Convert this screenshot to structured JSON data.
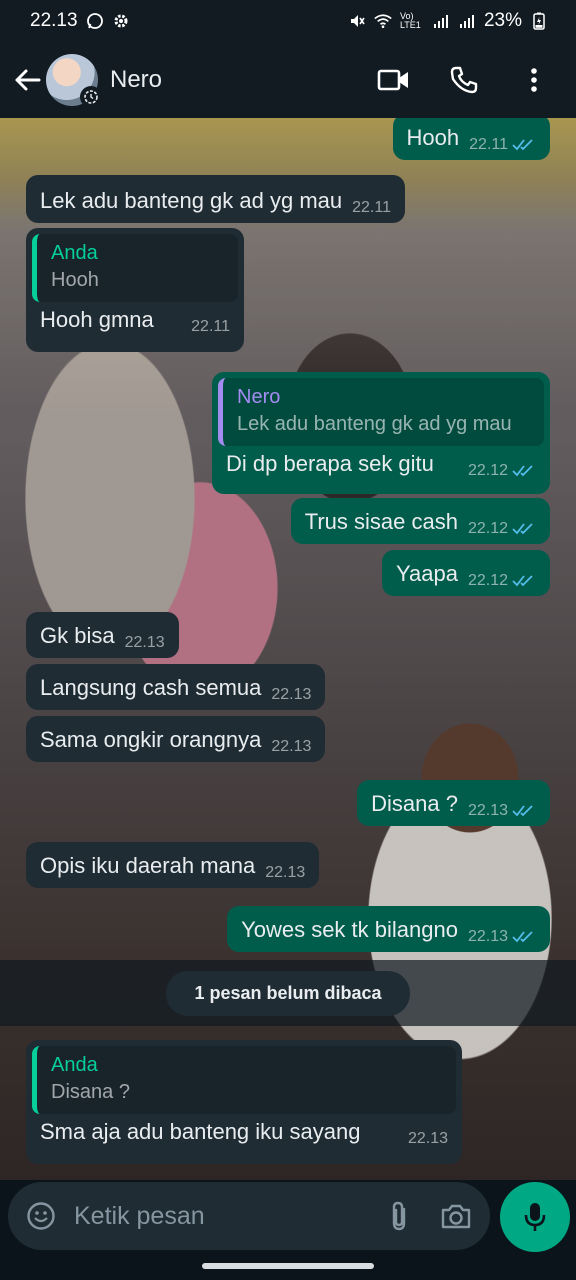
{
  "status_bar": {
    "time": "22.13",
    "battery": "23%",
    "network": "Vo) LTE1"
  },
  "header": {
    "contact_name": "Nero",
    "icons": [
      "back-arrow-icon",
      "video-call-icon",
      "phone-icon",
      "more-vert-icon"
    ]
  },
  "colors": {
    "incoming_bubble": "#1f2c34",
    "outgoing_bubble": "#005c4b",
    "accent": "#00a884",
    "tick_read": "#53bdeb",
    "quote_self": "#06cf9c",
    "quote_contact": "#a28cf0"
  },
  "messages": [
    {
      "dir": "out",
      "text": "Hooh",
      "time": "22.11",
      "read": true
    },
    {
      "dir": "in",
      "text": "Lek adu banteng gk ad yg mau",
      "time": "22.11"
    },
    {
      "dir": "in",
      "quote_author": "Anda",
      "quote_text": "Hooh",
      "text": "Hooh gmna",
      "time": "22.11"
    },
    {
      "dir": "out",
      "quote_author": "Nero",
      "quote_text": "Lek adu banteng gk ad yg mau",
      "text": "Di dp berapa sek gitu",
      "time": "22.12",
      "read": true
    },
    {
      "dir": "out",
      "text": "Trus sisae cash",
      "time": "22.12",
      "read": true
    },
    {
      "dir": "out",
      "text": "Yaapa",
      "time": "22.12",
      "read": true
    },
    {
      "dir": "in",
      "text": "Gk bisa",
      "time": "22.13"
    },
    {
      "dir": "in",
      "text": "Langsung cash semua",
      "time": "22.13"
    },
    {
      "dir": "in",
      "text": "Sama ongkir orangnya",
      "time": "22.13"
    },
    {
      "dir": "out",
      "text": "Disana ?",
      "time": "22.13",
      "read": true
    },
    {
      "dir": "in",
      "text": "Opis iku daerah mana",
      "time": "22.13"
    },
    {
      "dir": "out",
      "text": "Yowes sek tk bilangno",
      "time": "22.13",
      "read": true
    },
    {
      "dir": "in",
      "quote_author": "Anda",
      "quote_text": "Disana ?",
      "text": "Sma aja adu banteng iku sayang",
      "time": "22.13"
    }
  ],
  "unread_banner": "1 pesan belum dibaca",
  "composer": {
    "placeholder": "Ketik pesan",
    "icons": [
      "emoji-icon",
      "attach-icon",
      "camera-icon",
      "mic-icon"
    ]
  }
}
